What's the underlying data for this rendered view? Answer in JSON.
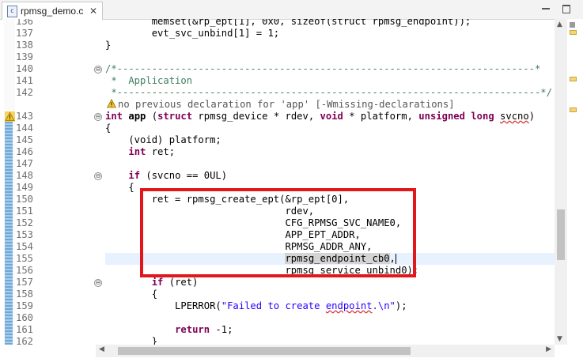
{
  "tab": {
    "title": "rpmsg_demo.c",
    "icon": "c-source-file-icon",
    "close": "✕"
  },
  "window": {
    "minimize": "minimize-icon",
    "maximize": "maximize-icon"
  },
  "colors": {
    "keyword": "#7f0055",
    "comment": "#3f7f5f",
    "string": "#2a00ff",
    "highlight": "#e8f2fe",
    "annotation_box": "#e0171b"
  },
  "lines": [
    {
      "num": "136",
      "segs": [
        [
          "",
          "        memset(&rp_ept[1], 0x0, sizeof(struct rpmsg_endpoint));"
        ]
      ]
    },
    {
      "num": "137",
      "segs": [
        [
          "",
          "        evt_svc_unbind[1] = 1;"
        ]
      ]
    },
    {
      "num": "138",
      "segs": [
        [
          "",
          "}"
        ]
      ]
    },
    {
      "num": "139",
      "segs": [
        [
          "",
          ""
        ]
      ]
    },
    {
      "num": "140",
      "fold": "⊖",
      "segs": [
        [
          "cm",
          "/*------------------------------------------------------------------------*"
        ]
      ]
    },
    {
      "num": "141",
      "segs": [
        [
          "cm",
          " *  Application"
        ]
      ]
    },
    {
      "num": "142",
      "segs": [
        [
          "cm",
          " *-------------------------------------------------------------------------*/"
        ]
      ]
    },
    {
      "num": "",
      "warning": true,
      "segs": [
        [
          "wtxt",
          "no previous declaration for 'app' [-Wmissing-declarations]"
        ]
      ]
    },
    {
      "num": "143",
      "fold": "⊖",
      "segs": [
        [
          "kw",
          "int"
        ],
        [
          "",
          " "
        ],
        [
          "b",
          "app"
        ],
        [
          "",
          " ("
        ],
        [
          "kw",
          "struct"
        ],
        [
          "",
          " rpmsg_device * rdev, "
        ],
        [
          "kw",
          "void"
        ],
        [
          "",
          " * platform, "
        ],
        [
          "kw",
          "unsigned"
        ],
        [
          "",
          " "
        ],
        [
          "kw",
          "long"
        ],
        [
          "",
          " "
        ],
        [
          "wavy",
          "svcno"
        ],
        [
          "",
          ")"
        ]
      ]
    },
    {
      "num": "144",
      "segs": [
        [
          "",
          "{"
        ]
      ]
    },
    {
      "num": "145",
      "segs": [
        [
          "",
          "    (void) platform;"
        ]
      ]
    },
    {
      "num": "146",
      "segs": [
        [
          "",
          "    "
        ],
        [
          "kw",
          "int"
        ],
        [
          "",
          " ret;"
        ]
      ]
    },
    {
      "num": "147",
      "segs": [
        [
          "",
          ""
        ]
      ]
    },
    {
      "num": "148",
      "fold": "⊖",
      "segs": [
        [
          "",
          "    "
        ],
        [
          "kw",
          "if"
        ],
        [
          "",
          " (svcno == 0UL)"
        ]
      ]
    },
    {
      "num": "149",
      "segs": [
        [
          "",
          "    {"
        ]
      ]
    },
    {
      "num": "150",
      "segs": [
        [
          "",
          "        ret = rpmsg_create_ept(&rp_ept[0],"
        ]
      ]
    },
    {
      "num": "151",
      "segs": [
        [
          "",
          "                               rdev,"
        ]
      ]
    },
    {
      "num": "152",
      "segs": [
        [
          "",
          "                               CFG_RPMSG_SVC_NAME0,"
        ]
      ]
    },
    {
      "num": "153",
      "segs": [
        [
          "",
          "                               APP_EPT_ADDR,"
        ]
      ]
    },
    {
      "num": "154",
      "segs": [
        [
          "",
          "                               RPMSG_ADDR_ANY,"
        ]
      ]
    },
    {
      "num": "155",
      "hl": true,
      "segs": [
        [
          "",
          "                               "
        ],
        [
          "occ",
          "rpmsg_endpoint_cb0"
        ],
        [
          "",
          ","
        ],
        [
          "caret",
          ""
        ]
      ]
    },
    {
      "num": "156",
      "segs": [
        [
          "",
          "                               rpmsg_service_unbind0);"
        ]
      ]
    },
    {
      "num": "157",
      "fold": "⊖",
      "segs": [
        [
          "",
          "        "
        ],
        [
          "kw",
          "if"
        ],
        [
          "",
          " (ret)"
        ]
      ]
    },
    {
      "num": "158",
      "segs": [
        [
          "",
          "        {"
        ]
      ]
    },
    {
      "num": "159",
      "segs": [
        [
          "",
          "            LPERROR("
        ],
        [
          "str",
          "\"Failed to create "
        ],
        [
          "strw",
          "endpoint"
        ],
        [
          "str",
          ".\\n\""
        ],
        [
          "",
          ");"
        ]
      ]
    },
    {
      "num": "160",
      "segs": [
        [
          "",
          ""
        ]
      ]
    },
    {
      "num": "161",
      "segs": [
        [
          "",
          "            "
        ],
        [
          "kw",
          "return"
        ],
        [
          "",
          " -1;"
        ]
      ]
    },
    {
      "num": "162",
      "segs": [
        [
          "",
          "        }"
        ]
      ]
    }
  ]
}
